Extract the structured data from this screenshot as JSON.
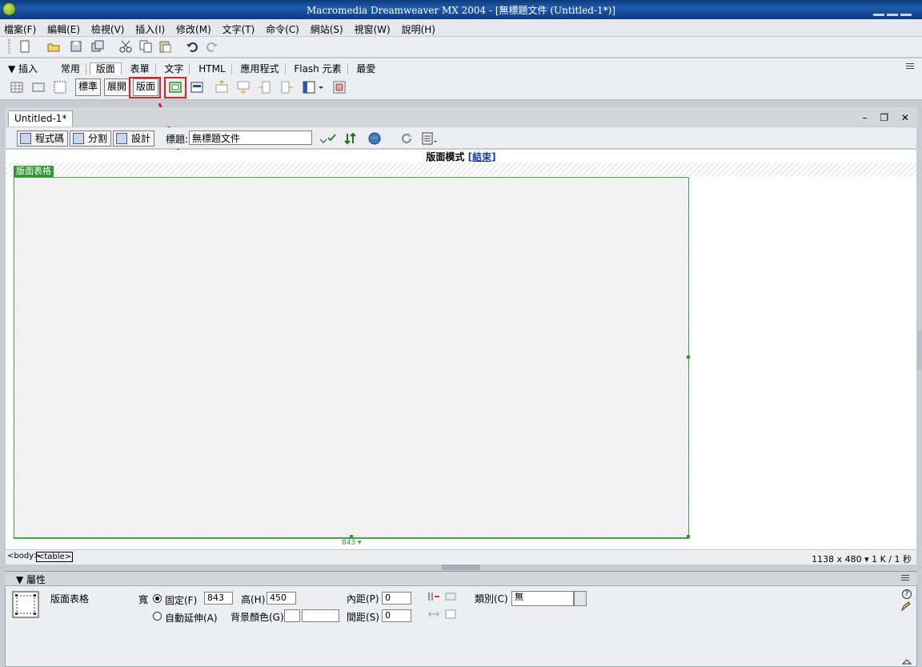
{
  "window": {
    "title": "Macromedia Dreamweaver MX 2004 - [無標題文件 (Untitled-1*)]"
  },
  "menu": [
    "檔案(F)",
    "編輯(E)",
    "檢視(V)",
    "插入(I)",
    "修改(M)",
    "文字(T)",
    "命令(C)",
    "網站(S)",
    "視窗(W)",
    "說明(H)"
  ],
  "insert_bar": {
    "title": "▼ 插入",
    "tabs": [
      "常用",
      "版面",
      "表單",
      "文字",
      "HTML",
      "應用程式",
      "Flash 元素",
      "最愛"
    ],
    "active_tab": "版面",
    "mode_buttons": [
      "標準",
      "展開",
      "版面"
    ]
  },
  "document": {
    "tab": "Untitled-1*",
    "controls": "– ❐ ✕",
    "view_buttons": [
      "程式碼",
      "分割",
      "設計"
    ],
    "title_label": "標題:",
    "title_value": "無標題文件",
    "layout_mode": "版面模式",
    "layout_exit": "[結束]",
    "layout_table_label": "版面表格",
    "width_indicator": "843 ▾"
  },
  "status": {
    "tags": [
      "<body>",
      "<table>"
    ],
    "size": "1138 x 480 ▾  1 K / 1 秒"
  },
  "properties": {
    "title": "▼ 屬性",
    "element_name": "版面表格",
    "width_label": "寬",
    "fixed_label": "固定(F)",
    "width_value": "843",
    "height_label": "高(H)",
    "height_value": "450",
    "autostretch_label": "自動延伸(A)",
    "bgcolor_label": "背景顏色(G)",
    "padding_label": "內距(P)",
    "padding_value": "0",
    "spacing_label": "間距(S)",
    "spacing_value": "0",
    "class_label": "類別(C)",
    "class_value": "無",
    "help_icon": "?"
  },
  "colors": {
    "highlight": "#e02020",
    "layout_green": "#2e9a2e",
    "title_bar": "#1e5cae"
  }
}
